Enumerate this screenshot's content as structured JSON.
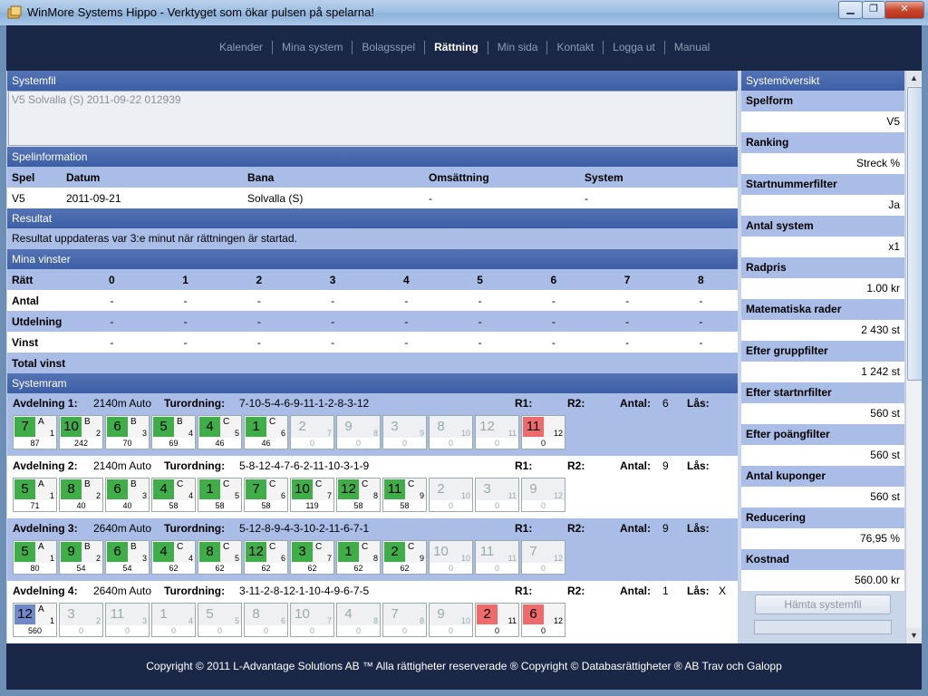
{
  "window": {
    "title": "WinMore Systems Hippo - Verktyget som ökar pulsen på spelarna!"
  },
  "nav": {
    "items": [
      "Kalender",
      "Mina system",
      "Bolagsspel",
      "Rättning",
      "Min sida",
      "Kontakt",
      "Logga ut",
      "Manual"
    ],
    "active": "Rättning"
  },
  "systemfil": {
    "header": "Systemfil",
    "value": "V5 Solvalla (S) 2011-09-22 012939"
  },
  "spelinfo": {
    "header": "Spelinformation",
    "columns": [
      "Spel",
      "Datum",
      "Bana",
      "Omsättning",
      "System"
    ],
    "row": [
      "V5",
      "2011-09-21",
      "Solvalla (S)",
      "-",
      "-"
    ]
  },
  "resultat": {
    "header": "Resultat",
    "text": "Resultat uppdateras var 3:e minut när rättningen är startad."
  },
  "vinster": {
    "header": "Mina vinster",
    "columns": [
      "Rätt",
      "0",
      "1",
      "2",
      "3",
      "4",
      "5",
      "6",
      "7",
      "8"
    ],
    "rows": [
      {
        "label": "Antal",
        "values": [
          "-",
          "-",
          "-",
          "-",
          "-",
          "-",
          "-",
          "-",
          "-"
        ]
      },
      {
        "label": "Utdelning",
        "values": [
          "-",
          "-",
          "-",
          "-",
          "-",
          "-",
          "-",
          "-",
          "-"
        ]
      },
      {
        "label": "Vinst",
        "values": [
          "-",
          "-",
          "-",
          "-",
          "-",
          "-",
          "-",
          "-",
          "-"
        ]
      }
    ],
    "total_label": "Total vinst"
  },
  "systemram": {
    "header": "Systemram",
    "labels": {
      "turordning": "Turordning:",
      "r1": "R1:",
      "r2": "R2:",
      "antal": "Antal:",
      "las": "Lås:"
    },
    "avdelningar": [
      {
        "name": "Avdelning 1:",
        "dist": "2140m Auto",
        "turordning": "7-10-5-4-6-9-11-1-2-8-3-12",
        "antal": "6",
        "las": "",
        "horses": [
          {
            "n": "7",
            "l": "A",
            "s": "1",
            "v": "87",
            "st": "green"
          },
          {
            "n": "10",
            "l": "B",
            "s": "2",
            "v": "242",
            "st": "green"
          },
          {
            "n": "6",
            "l": "B",
            "s": "3",
            "v": "70",
            "st": "green"
          },
          {
            "n": "5",
            "l": "B",
            "s": "4",
            "v": "69",
            "st": "green"
          },
          {
            "n": "4",
            "l": "C",
            "s": "5",
            "v": "46",
            "st": "green"
          },
          {
            "n": "1",
            "l": "C",
            "s": "6",
            "v": "46",
            "st": "green"
          },
          {
            "n": "2",
            "l": "",
            "s": "7",
            "v": "0",
            "st": "empty"
          },
          {
            "n": "9",
            "l": "",
            "s": "8",
            "v": "0",
            "st": "empty"
          },
          {
            "n": "3",
            "l": "",
            "s": "9",
            "v": "0",
            "st": "empty"
          },
          {
            "n": "8",
            "l": "",
            "s": "10",
            "v": "0",
            "st": "empty"
          },
          {
            "n": "12",
            "l": "",
            "s": "11",
            "v": "0",
            "st": "empty"
          },
          {
            "n": "11",
            "l": "",
            "s": "12",
            "v": "0",
            "st": "red"
          }
        ]
      },
      {
        "name": "Avdelning 2:",
        "dist": "2140m Auto",
        "turordning": "5-8-12-4-7-6-2-11-10-3-1-9",
        "antal": "9",
        "las": "",
        "horses": [
          {
            "n": "5",
            "l": "A",
            "s": "1",
            "v": "71",
            "st": "green"
          },
          {
            "n": "8",
            "l": "B",
            "s": "2",
            "v": "40",
            "st": "green"
          },
          {
            "n": "6",
            "l": "B",
            "s": "3",
            "v": "40",
            "st": "green"
          },
          {
            "n": "4",
            "l": "C",
            "s": "4",
            "v": "58",
            "st": "green"
          },
          {
            "n": "1",
            "l": "C",
            "s": "5",
            "v": "58",
            "st": "green"
          },
          {
            "n": "7",
            "l": "C",
            "s": "6",
            "v": "58",
            "st": "green"
          },
          {
            "n": "10",
            "l": "C",
            "s": "7",
            "v": "119",
            "st": "green"
          },
          {
            "n": "12",
            "l": "C",
            "s": "8",
            "v": "58",
            "st": "green"
          },
          {
            "n": "11",
            "l": "C",
            "s": "9",
            "v": "58",
            "st": "green"
          },
          {
            "n": "2",
            "l": "",
            "s": "10",
            "v": "0",
            "st": "empty"
          },
          {
            "n": "3",
            "l": "",
            "s": "11",
            "v": "0",
            "st": "empty"
          },
          {
            "n": "9",
            "l": "",
            "s": "12",
            "v": "0",
            "st": "empty"
          }
        ]
      },
      {
        "name": "Avdelning 3:",
        "dist": "2640m Auto",
        "turordning": "5-12-8-9-4-3-10-2-11-6-7-1",
        "antal": "9",
        "las": "",
        "horses": [
          {
            "n": "5",
            "l": "A",
            "s": "1",
            "v": "80",
            "st": "green"
          },
          {
            "n": "9",
            "l": "B",
            "s": "2",
            "v": "54",
            "st": "green"
          },
          {
            "n": "6",
            "l": "B",
            "s": "3",
            "v": "54",
            "st": "green"
          },
          {
            "n": "4",
            "l": "C",
            "s": "4",
            "v": "62",
            "st": "green"
          },
          {
            "n": "8",
            "l": "C",
            "s": "5",
            "v": "62",
            "st": "green"
          },
          {
            "n": "12",
            "l": "C",
            "s": "6",
            "v": "62",
            "st": "green"
          },
          {
            "n": "3",
            "l": "C",
            "s": "7",
            "v": "62",
            "st": "green"
          },
          {
            "n": "1",
            "l": "C",
            "s": "8",
            "v": "62",
            "st": "green"
          },
          {
            "n": "2",
            "l": "C",
            "s": "9",
            "v": "62",
            "st": "green"
          },
          {
            "n": "10",
            "l": "",
            "s": "10",
            "v": "0",
            "st": "empty"
          },
          {
            "n": "11",
            "l": "",
            "s": "11",
            "v": "0",
            "st": "empty"
          },
          {
            "n": "7",
            "l": "",
            "s": "12",
            "v": "0",
            "st": "empty"
          }
        ]
      },
      {
        "name": "Avdelning 4:",
        "dist": "2640m Auto",
        "turordning": "3-11-2-8-12-1-10-4-9-6-7-5",
        "antal": "1",
        "las": "X",
        "horses": [
          {
            "n": "12",
            "l": "A",
            "s": "1",
            "v": "560",
            "st": "blue"
          },
          {
            "n": "3",
            "l": "",
            "s": "2",
            "v": "0",
            "st": "empty"
          },
          {
            "n": "11",
            "l": "",
            "s": "3",
            "v": "0",
            "st": "empty"
          },
          {
            "n": "1",
            "l": "",
            "s": "4",
            "v": "0",
            "st": "empty"
          },
          {
            "n": "5",
            "l": "",
            "s": "5",
            "v": "0",
            "st": "empty"
          },
          {
            "n": "8",
            "l": "",
            "s": "6",
            "v": "0",
            "st": "empty"
          },
          {
            "n": "10",
            "l": "",
            "s": "7",
            "v": "0",
            "st": "empty"
          },
          {
            "n": "4",
            "l": "",
            "s": "8",
            "v": "0",
            "st": "empty"
          },
          {
            "n": "7",
            "l": "",
            "s": "8",
            "v": "0",
            "st": "empty"
          },
          {
            "n": "9",
            "l": "",
            "s": "10",
            "v": "0",
            "st": "empty"
          },
          {
            "n": "2",
            "l": "",
            "s": "11",
            "v": "0",
            "st": "red"
          },
          {
            "n": "6",
            "l": "",
            "s": "12",
            "v": "0",
            "st": "red"
          }
        ]
      }
    ]
  },
  "oversikt": {
    "header": "Systemöversikt",
    "items": [
      {
        "label": "Spelform",
        "value": "V5"
      },
      {
        "label": "Ranking",
        "value": "Streck %"
      },
      {
        "label": "Startnummerfilter",
        "value": "Ja"
      },
      {
        "label": "Antal system",
        "value": "x1"
      },
      {
        "label": "Radpris",
        "value": "1.00 kr"
      },
      {
        "label": "Matematiska rader",
        "value": "2 430 st"
      },
      {
        "label": "Efter gruppfilter",
        "value": "1 242 st"
      },
      {
        "label": "Efter startnrfilter",
        "value": "560 st"
      },
      {
        "label": "Efter poängfilter",
        "value": "560 st"
      },
      {
        "label": "Antal kuponger",
        "value": "560 st"
      },
      {
        "label": "Reducering",
        "value": "76,95 %"
      },
      {
        "label": "Kostnad",
        "value": "560.00 kr"
      }
    ],
    "button": "Hämta systemfil"
  },
  "footer": {
    "text": "Copyright © 2011 L-Advantage Solutions AB ™ Alla rättigheter reserverade ® Copyright © Databasrättigheter ® AB Trav och Galopp"
  }
}
